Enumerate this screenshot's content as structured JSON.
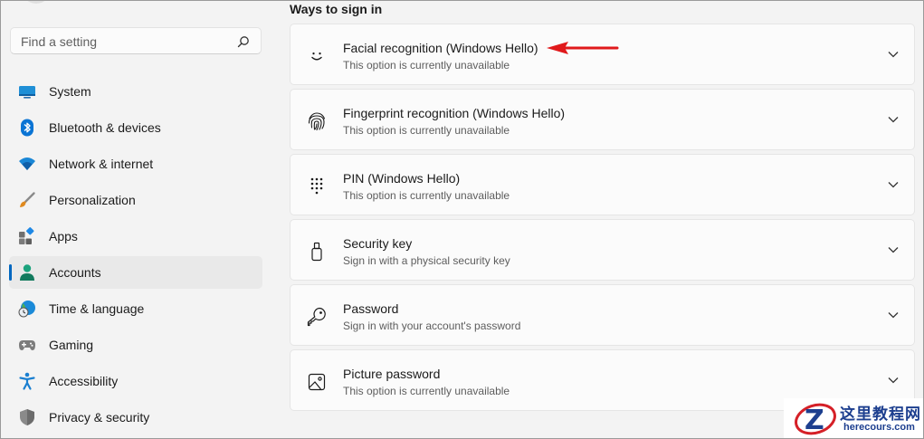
{
  "search": {
    "placeholder": "Find a setting"
  },
  "nav": {
    "items": [
      {
        "label": "System",
        "icon": "monitor-icon"
      },
      {
        "label": "Bluetooth & devices",
        "icon": "bluetooth-icon"
      },
      {
        "label": "Network & internet",
        "icon": "wifi-icon"
      },
      {
        "label": "Personalization",
        "icon": "brush-icon"
      },
      {
        "label": "Apps",
        "icon": "apps-icon"
      },
      {
        "label": "Accounts",
        "icon": "person-icon",
        "selected": true
      },
      {
        "label": "Time & language",
        "icon": "clock-globe-icon"
      },
      {
        "label": "Gaming",
        "icon": "gamepad-icon"
      },
      {
        "label": "Accessibility",
        "icon": "accessibility-icon"
      },
      {
        "label": "Privacy & security",
        "icon": "shield-icon"
      }
    ]
  },
  "main": {
    "section_title": "Ways to sign in",
    "options": [
      {
        "title": "Facial recognition (Windows Hello)",
        "subtitle": "This option is currently unavailable",
        "icon": "smiley-face-icon"
      },
      {
        "title": "Fingerprint recognition (Windows Hello)",
        "subtitle": "This option is currently unavailable",
        "icon": "fingerprint-icon"
      },
      {
        "title": "PIN (Windows Hello)",
        "subtitle": "This option is currently unavailable",
        "icon": "pin-keypad-icon"
      },
      {
        "title": "Security key",
        "subtitle": "Sign in with a physical security key",
        "icon": "usb-key-icon"
      },
      {
        "title": "Password",
        "subtitle": "Sign in with your account's password",
        "icon": "key-icon"
      },
      {
        "title": "Picture password",
        "subtitle": "This option is currently unavailable",
        "icon": "picture-icon"
      }
    ]
  },
  "annotation": {
    "arrow_color": "#e0191b"
  },
  "watermark": {
    "title": "这里教程网",
    "url": "herecours.com",
    "logo_letter": "Z"
  },
  "colors": {
    "accent": "#0067c0",
    "background": "#f3f3f3",
    "card": "#fbfbfb"
  }
}
